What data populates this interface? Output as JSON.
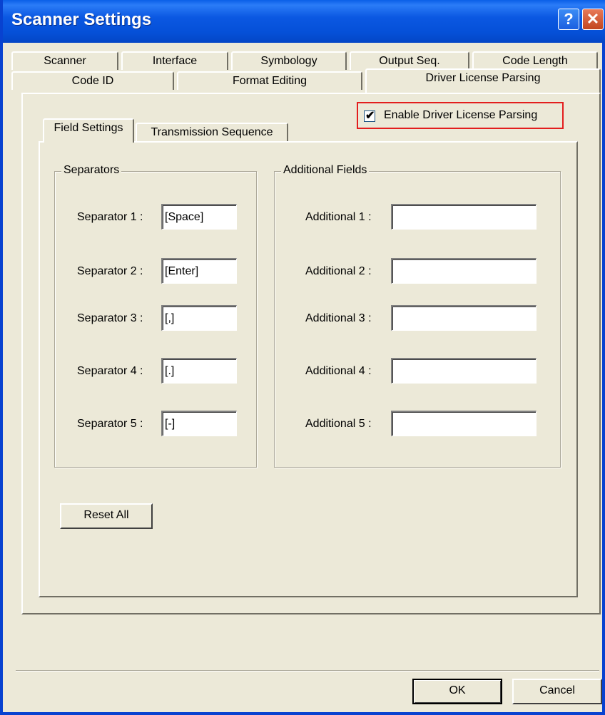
{
  "window": {
    "title": "Scanner Settings"
  },
  "titlebar_buttons": {
    "help_label": "?",
    "close_label": "✕"
  },
  "tabs": {
    "row1": [
      "Scanner",
      "Interface",
      "Symbology",
      "Output Seq.",
      "Code Length"
    ],
    "row2": [
      "Code ID",
      "Format Editing",
      "Driver License Parsing"
    ],
    "active": "Driver License Parsing"
  },
  "enable_checkbox": {
    "label": "Enable Driver License Parsing",
    "checked": true
  },
  "subtabs": {
    "items": [
      "Field Settings",
      "Transmission Sequence"
    ],
    "active": "Field Settings"
  },
  "separators": {
    "title": "Separators",
    "items": [
      {
        "label": "Separator 1 :",
        "value": "[Space]"
      },
      {
        "label": "Separator 2 :",
        "value": "[Enter]"
      },
      {
        "label": "Separator 3 :",
        "value": "[,]"
      },
      {
        "label": "Separator 4 :",
        "value": "[.]"
      },
      {
        "label": "Separator 5 :",
        "value": "[-]"
      }
    ]
  },
  "additional": {
    "title": "Additional Fields",
    "items": [
      {
        "label": "Additional 1 :",
        "value": ""
      },
      {
        "label": "Additional 2 :",
        "value": ""
      },
      {
        "label": "Additional 3 :",
        "value": ""
      },
      {
        "label": "Additional 4 :",
        "value": ""
      },
      {
        "label": "Additional 5 :",
        "value": ""
      }
    ]
  },
  "buttons": {
    "reset_all": "Reset All",
    "ok": "OK",
    "cancel": "Cancel"
  },
  "colors": {
    "title_bar": "#0b58e2",
    "highlight_border": "#e31e1e",
    "dialog_bg": "#ece9d8"
  }
}
